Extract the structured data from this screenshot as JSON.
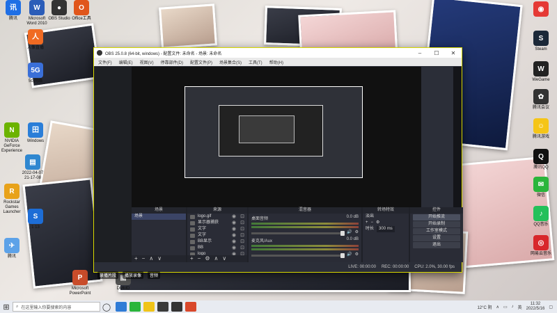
{
  "desktop_icons_left": [
    {
      "label": "腾讯",
      "color": "#1f6fe5",
      "glyph": "讯"
    },
    {
      "label": "Microsoft Word 2010",
      "color": "#2b5db8",
      "glyph": "W"
    },
    {
      "label": "OBS Studio",
      "color": "#333333",
      "glyph": "●"
    },
    {
      "label": "Office工具",
      "color": "#e0561b",
      "glyph": "O"
    },
    {
      "label": "人像直播",
      "color": "#f06a22",
      "glyph": "人"
    },
    {
      "label": "5G网络",
      "color": "#3a6fd8",
      "glyph": "5G"
    },
    {
      "label": "NVIDIA GeForce Experience",
      "color": "#6bb300",
      "glyph": "N"
    },
    {
      "label": "Windows",
      "color": "#2a7ed8",
      "glyph": "田"
    },
    {
      "label": "2022-04-07 21-17-08",
      "color": "#2f87d0",
      "glyph": "▤"
    },
    {
      "label": "Rockstar Games Launcher",
      "color": "#e8a21a",
      "glyph": "R"
    },
    {
      "label": "1 13",
      "color": "#1d6dd6",
      "glyph": "S"
    },
    {
      "label": "腾讯",
      "color": "#5da2e8",
      "glyph": "✈"
    },
    {
      "label": "Microsoft PowerPoint",
      "color": "#c94c2a",
      "glyph": "P"
    },
    {
      "label": "DMMD",
      "color": "#555555",
      "glyph": "▣"
    }
  ],
  "desktop_icons_right": [
    {
      "label": "",
      "color": "#e53935",
      "glyph": "◉"
    },
    {
      "label": "Steam",
      "color": "#1b2838",
      "glyph": "S"
    },
    {
      "label": "WeGame",
      "color": "#222222",
      "glyph": "W"
    },
    {
      "label": "腾讯会议",
      "color": "#333333",
      "glyph": "✿"
    },
    {
      "label": "腾讯游戏",
      "color": "#f5c518",
      "glyph": "☺"
    },
    {
      "label": "腾讯QQ",
      "color": "#111111",
      "glyph": "Q"
    },
    {
      "label": "微信",
      "color": "#2ab53b",
      "glyph": "✉"
    },
    {
      "label": "QQ音乐",
      "color": "#24c05a",
      "glyph": "♪"
    },
    {
      "label": "网易云音乐",
      "color": "#d8272b",
      "glyph": "◎"
    }
  ],
  "obs": {
    "title": "OBS 25.0.8 (64-bit, windows) - 配置文件: 未命名 - 场景: 未命名",
    "menu": [
      "文件(F)",
      "编辑(E)",
      "视图(V)",
      "停靠部件(D)",
      "配置文件(P)",
      "场景集合(S)",
      "工具(T)",
      "帮助(H)"
    ],
    "docks": {
      "scenes": {
        "header": "场景",
        "items": [
          "场景"
        ]
      },
      "sources": {
        "header": "来源",
        "items": [
          "logo.gif",
          "显示器捕获",
          "文字",
          "文字",
          "BB显示",
          "BB",
          "logo"
        ]
      },
      "mixer": {
        "header": "混音器",
        "channels": [
          {
            "name": "桌面音频",
            "level": "0.0 dB"
          },
          {
            "name": "麦克风/Aux",
            "level": "0.0 dB"
          }
        ]
      },
      "transitions": {
        "header": "转场特效",
        "mode": "淡出",
        "duration_label": "时长",
        "duration": "300 ms"
      },
      "controls": {
        "header": "控件",
        "buttons": [
          "开始推流",
          "开始录制",
          "工作室模式",
          "设置",
          "退出"
        ]
      }
    },
    "status": {
      "live": "LIVE: 00:00:00",
      "rec": "REC: 00:00:00",
      "cpu": "CPU: 2.0%, 30.00 fps"
    }
  },
  "mini_toolbar": [
    "录播片段",
    "播放录像",
    "音频"
  ],
  "taskbar": {
    "search_placeholder": "在这里输入你要搜索的内容",
    "weather": "12°C 阴",
    "lang": "英",
    "time": "11:32",
    "date": "2022/5/16"
  }
}
